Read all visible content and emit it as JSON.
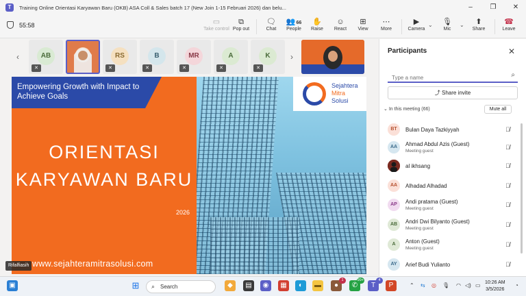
{
  "window": {
    "title": "Training Online Orientasi Karyawan Baru (OKB) ASA Coll & Sales batch 17 (New Join 1-15 Februari 2026) dan belu...",
    "controls": [
      "–",
      "❐",
      "✕"
    ]
  },
  "toolbar": {
    "timer": "55:58",
    "buttons": [
      {
        "label": "Take control",
        "icon": "take-control-icon"
      },
      {
        "label": "Pop out",
        "icon": "pop-out-icon"
      },
      {
        "label": "Chat",
        "icon": "chat-icon"
      },
      {
        "label": "People",
        "icon": "people-icon",
        "count": "66"
      },
      {
        "label": "Raise",
        "icon": "raise-hand-icon"
      },
      {
        "label": "React",
        "icon": "react-icon"
      },
      {
        "label": "View",
        "icon": "view-icon"
      },
      {
        "label": "More",
        "icon": "more-icon"
      },
      {
        "label": "Camera",
        "icon": "camera-icon"
      },
      {
        "label": "Mic",
        "icon": "mic-icon"
      },
      {
        "label": "Share",
        "icon": "share-icon"
      },
      {
        "label": "Leave",
        "icon": "leave-icon"
      }
    ]
  },
  "thumbnails": [
    {
      "initials": "AB",
      "bg": "#d9ead3",
      "fg": "#4a6b3a"
    },
    {
      "initials": "",
      "bg": "#e07b4a",
      "fg": "#fff"
    },
    {
      "initials": "RS",
      "bg": "#f5e0c0",
      "fg": "#8a6a30"
    },
    {
      "initials": "B",
      "bg": "#d4e6ec",
      "fg": "#3a6070"
    },
    {
      "initials": "MR",
      "bg": "#f4d6da",
      "fg": "#8a3a48"
    },
    {
      "initials": "A",
      "bg": "#dbead2",
      "fg": "#4a6b3a"
    },
    {
      "initials": "K",
      "bg": "#dbead2",
      "fg": "#4a6b3a"
    }
  ],
  "slide": {
    "tagline": "Empowering Growth with Impact to Achieve Goals",
    "heading_line1": "ORIENTASI",
    "heading_line2": "KARYAWAN BARU",
    "year": "2026",
    "website": "www.sejahteramitrasolusi.com",
    "logo_line1": "Sejahtera",
    "logo_line2": "Mitra",
    "logo_line3": "Solusi",
    "presenter": "Rifalfiasih"
  },
  "panel": {
    "title": "Participants",
    "search_placeholder": "Type a name",
    "share_invite": "Share invite",
    "section_label": "In this meeting (66)",
    "mute_all": "Mute all",
    "participants": [
      {
        "initials": "BT",
        "name": "Bulan Daya Tazkiyyah",
        "sub": "",
        "bg": "#fbe0d8",
        "fg": "#b5502f"
      },
      {
        "initials": "AA",
        "name": "Ahmad Abdul Azis (Guest)",
        "sub": "Meeting guest",
        "bg": "#d6e7f0",
        "fg": "#3a6a8a"
      },
      {
        "initials": "",
        "name": "al ikhsang",
        "sub": "",
        "bg": "#7a2a20",
        "fg": "#fff"
      },
      {
        "initials": "AA",
        "name": "Alhadad Alhadad",
        "sub": "",
        "bg": "#fbe0d8",
        "fg": "#b5502f"
      },
      {
        "initials": "AP",
        "name": "Andi pratama (Guest)",
        "sub": "Meeting guest",
        "bg": "#f1dbf0",
        "fg": "#8a3a88"
      },
      {
        "initials": "AB",
        "name": "Andri Dwi Bilyanto (Guest)",
        "sub": "Meeting guest",
        "bg": "#dfe9d6",
        "fg": "#4a6b3a"
      },
      {
        "initials": "A",
        "name": "Anton (Guest)",
        "sub": "Meeting guest",
        "bg": "#dfe9d6",
        "fg": "#4a6b3a"
      },
      {
        "initials": "AY",
        "name": "Arief Budi Yulianto",
        "sub": "",
        "bg": "#d6e7f0",
        "fg": "#3a6a8a"
      }
    ]
  },
  "taskbar": {
    "search_label": "Search",
    "time": "10:26 AM",
    "date": "3/5/2026",
    "badge_1": "1",
    "badge_99": "99+",
    "badge_4": "4"
  }
}
